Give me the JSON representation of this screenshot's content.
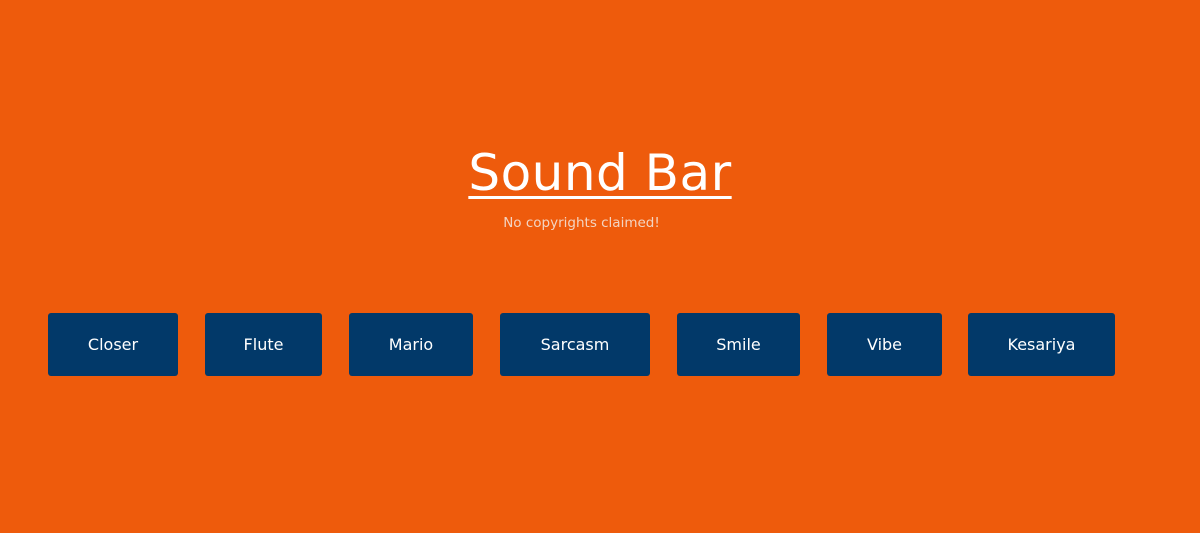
{
  "header": {
    "title": "Sound Bar",
    "subtitle": "No copyrights claimed!"
  },
  "buttons": [
    {
      "label": "Closer"
    },
    {
      "label": "Flute"
    },
    {
      "label": "Mario"
    },
    {
      "label": "Sarcasm"
    },
    {
      "label": "Smile"
    },
    {
      "label": "Vibe"
    },
    {
      "label": "Kesariya"
    }
  ],
  "colors": {
    "background": "#ee5b0c",
    "button": "#023969",
    "text": "#ffffff"
  }
}
